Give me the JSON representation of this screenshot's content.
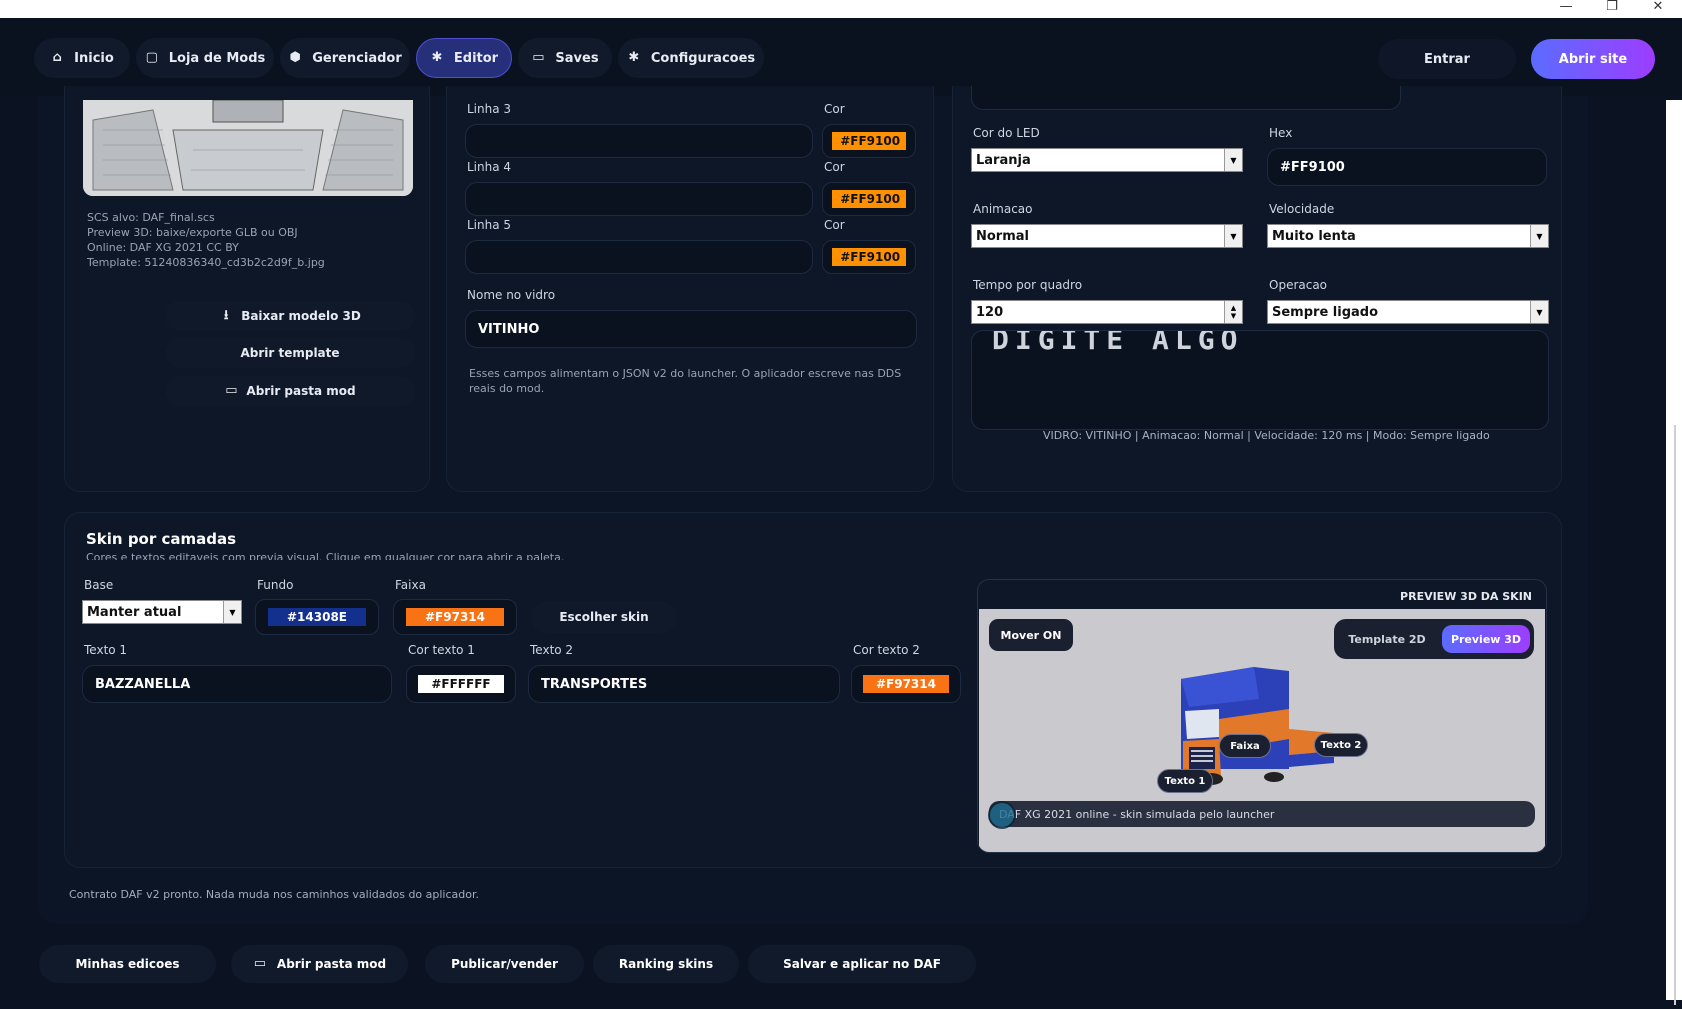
{
  "window": {
    "minimize_icon": "—",
    "restore_icon": "❐",
    "close_icon": "✕"
  },
  "nav": {
    "items": [
      {
        "label": "Inicio",
        "icon": "home-icon"
      },
      {
        "label": "Loja de Mods",
        "icon": "bag-icon"
      },
      {
        "label": "Gerenciador",
        "icon": "cube-icon"
      },
      {
        "label": "Editor",
        "icon": "gear-icon"
      },
      {
        "label": "Saves",
        "icon": "folder-icon"
      },
      {
        "label": "Configuracoes",
        "icon": "gear-icon"
      }
    ],
    "login": "Entrar",
    "open_site": "Abrir site"
  },
  "left": {
    "info": [
      "SCS alvo: DAF_final.scs",
      "Preview 3D: baixe/exporte GLB ou OBJ",
      "Online: DAF XG 2021 CC BY",
      "Template: 51240836340_cd3b2c2d9f_b.jpg"
    ],
    "download_model": "Baixar modelo 3D",
    "open_template": "Abrir template",
    "open_mod_folder": "Abrir pasta mod"
  },
  "middle": {
    "lines": [
      {
        "label": "Linha 3",
        "value": "",
        "color_label": "Cor",
        "hex": "#FF9100"
      },
      {
        "label": "Linha 4",
        "value": "",
        "color_label": "Cor",
        "hex": "#FF9100"
      },
      {
        "label": "Linha 5",
        "value": "",
        "color_label": "Cor",
        "hex": "#FF9100"
      }
    ],
    "glass_label": "Nome no vidro",
    "glass_value": "VITINHO",
    "note": "Esses campos alimentam o JSON v2 do launcher. O aplicador escreve nas DDS reais do mod."
  },
  "right": {
    "led_label": "Cor do LED",
    "led_value": "Laranja",
    "hex_label": "Hex",
    "hex_value": "#FF9100",
    "anim_label": "Animacao",
    "anim_value": "Normal",
    "speed_label": "Velocidade",
    "speed_value": "Muito lenta",
    "frame_label": "Tempo por quadro",
    "frame_value": "120",
    "op_label": "Operacao",
    "op_value": "Sempre ligado",
    "preview_text": "DIGITE ALGO",
    "status": "VIDRO: VITINHO | Animacao: Normal | Velocidade: 120 ms | Modo: Sempre ligado"
  },
  "skin": {
    "title": "Skin por camadas",
    "subtitle": "Cores e textos editaveis com previa visual. Clique em qualquer cor para abrir a paleta.",
    "base_label": "Base",
    "base_value": "Manter atual",
    "bg_label": "Fundo",
    "bg_hex": "#14308E",
    "stripe_label": "Faixa",
    "stripe_hex": "#F97314",
    "choose_skin": "Escolher skin",
    "text1_label": "Texto 1",
    "text1_value": "BAZZANELLA",
    "text1_color_label": "Cor texto 1",
    "text1_color": "#FFFFFF",
    "text2_label": "Texto 2",
    "text2_value": "TRANSPORTES",
    "text2_color_label": "Cor texto 2",
    "text2_color": "#F97314"
  },
  "preview": {
    "header": "PREVIEW 3D DA SKIN",
    "move": "Mover ON",
    "tab_2d": "Template 2D",
    "tab_3d": "Preview 3D",
    "tag_faixa": "Faixa",
    "tag_texto2": "Texto 2",
    "tag_texto1": "Texto 1",
    "caption": "DAF XG 2021 online - skin simulada pelo launcher"
  },
  "footer_note": "Contrato DAF v2 pronto. Nada muda nos caminhos validados do aplicador.",
  "bottom": {
    "my_editions": "Minhas edicoes",
    "open_mod_folder": "Abrir pasta mod",
    "publish": "Publicar/vender",
    "ranking": "Ranking skins",
    "save_apply": "Salvar e aplicar no DAF"
  },
  "colors": {
    "accent_start": "#5b6cff",
    "accent_end": "#9d3dff",
    "orange": "#FF9100",
    "blue": "#14308E",
    "stripe": "#F97314"
  }
}
